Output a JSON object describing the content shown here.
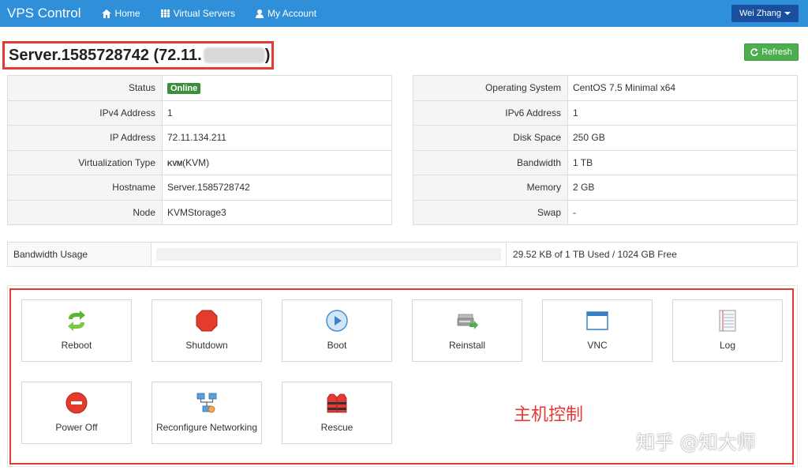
{
  "navbar": {
    "brand": "VPS Control",
    "items": [
      {
        "label": "Home",
        "icon": "home-icon"
      },
      {
        "label": "Virtual Servers",
        "icon": "grid-icon"
      },
      {
        "label": "My Account",
        "icon": "user-icon"
      }
    ],
    "user": "Wei Zhang"
  },
  "header": {
    "title": "Server.1585728742 (72.11.",
    "title_suffix": ")",
    "refresh_label": "Refresh"
  },
  "info_left": [
    {
      "label": "Status",
      "value": "Online"
    },
    {
      "label": "IPv4 Address",
      "value": "1"
    },
    {
      "label": "IP Address",
      "value": "72.11.134.211"
    },
    {
      "label": "Virtualization Type",
      "value": "(KVM)",
      "logo": "KVM"
    },
    {
      "label": "Hostname",
      "value": "Server.1585728742"
    },
    {
      "label": "Node",
      "value": "KVMStorage3"
    }
  ],
  "info_right": [
    {
      "label": "Operating System",
      "value": "CentOS 7.5 Minimal x64"
    },
    {
      "label": "IPv6 Address",
      "value": "1"
    },
    {
      "label": "Disk Space",
      "value": "250 GB"
    },
    {
      "label": "Bandwidth",
      "value": "1 TB"
    },
    {
      "label": "Memory",
      "value": "2 GB"
    },
    {
      "label": "Swap",
      "value": "-"
    }
  ],
  "bandwidth": {
    "label": "Bandwidth Usage",
    "usage_fraction": 0.0,
    "text": "29.52 KB of 1 TB Used / 1024 GB Free"
  },
  "controls": {
    "tiles": [
      {
        "label": "Reboot",
        "icon": "reboot-icon"
      },
      {
        "label": "Shutdown",
        "icon": "shutdown-icon"
      },
      {
        "label": "Boot",
        "icon": "boot-icon"
      },
      {
        "label": "Reinstall",
        "icon": "reinstall-icon"
      },
      {
        "label": "VNC",
        "icon": "vnc-icon"
      },
      {
        "label": "Log",
        "icon": "log-icon"
      },
      {
        "label": "Power Off",
        "icon": "power-off-icon"
      },
      {
        "label": "Reconfigure Networking",
        "icon": "network-icon"
      },
      {
        "label": "Rescue",
        "icon": "rescue-icon"
      }
    ],
    "annotation": "主机控制"
  },
  "watermark": "知乎 @知大师",
  "colors": {
    "navbar": "#2f8fd8",
    "user_button": "#1a4fa0",
    "refresh_button": "#4cae4c",
    "online_badge": "#3c8f3c",
    "highlight_border": "#e53935"
  }
}
